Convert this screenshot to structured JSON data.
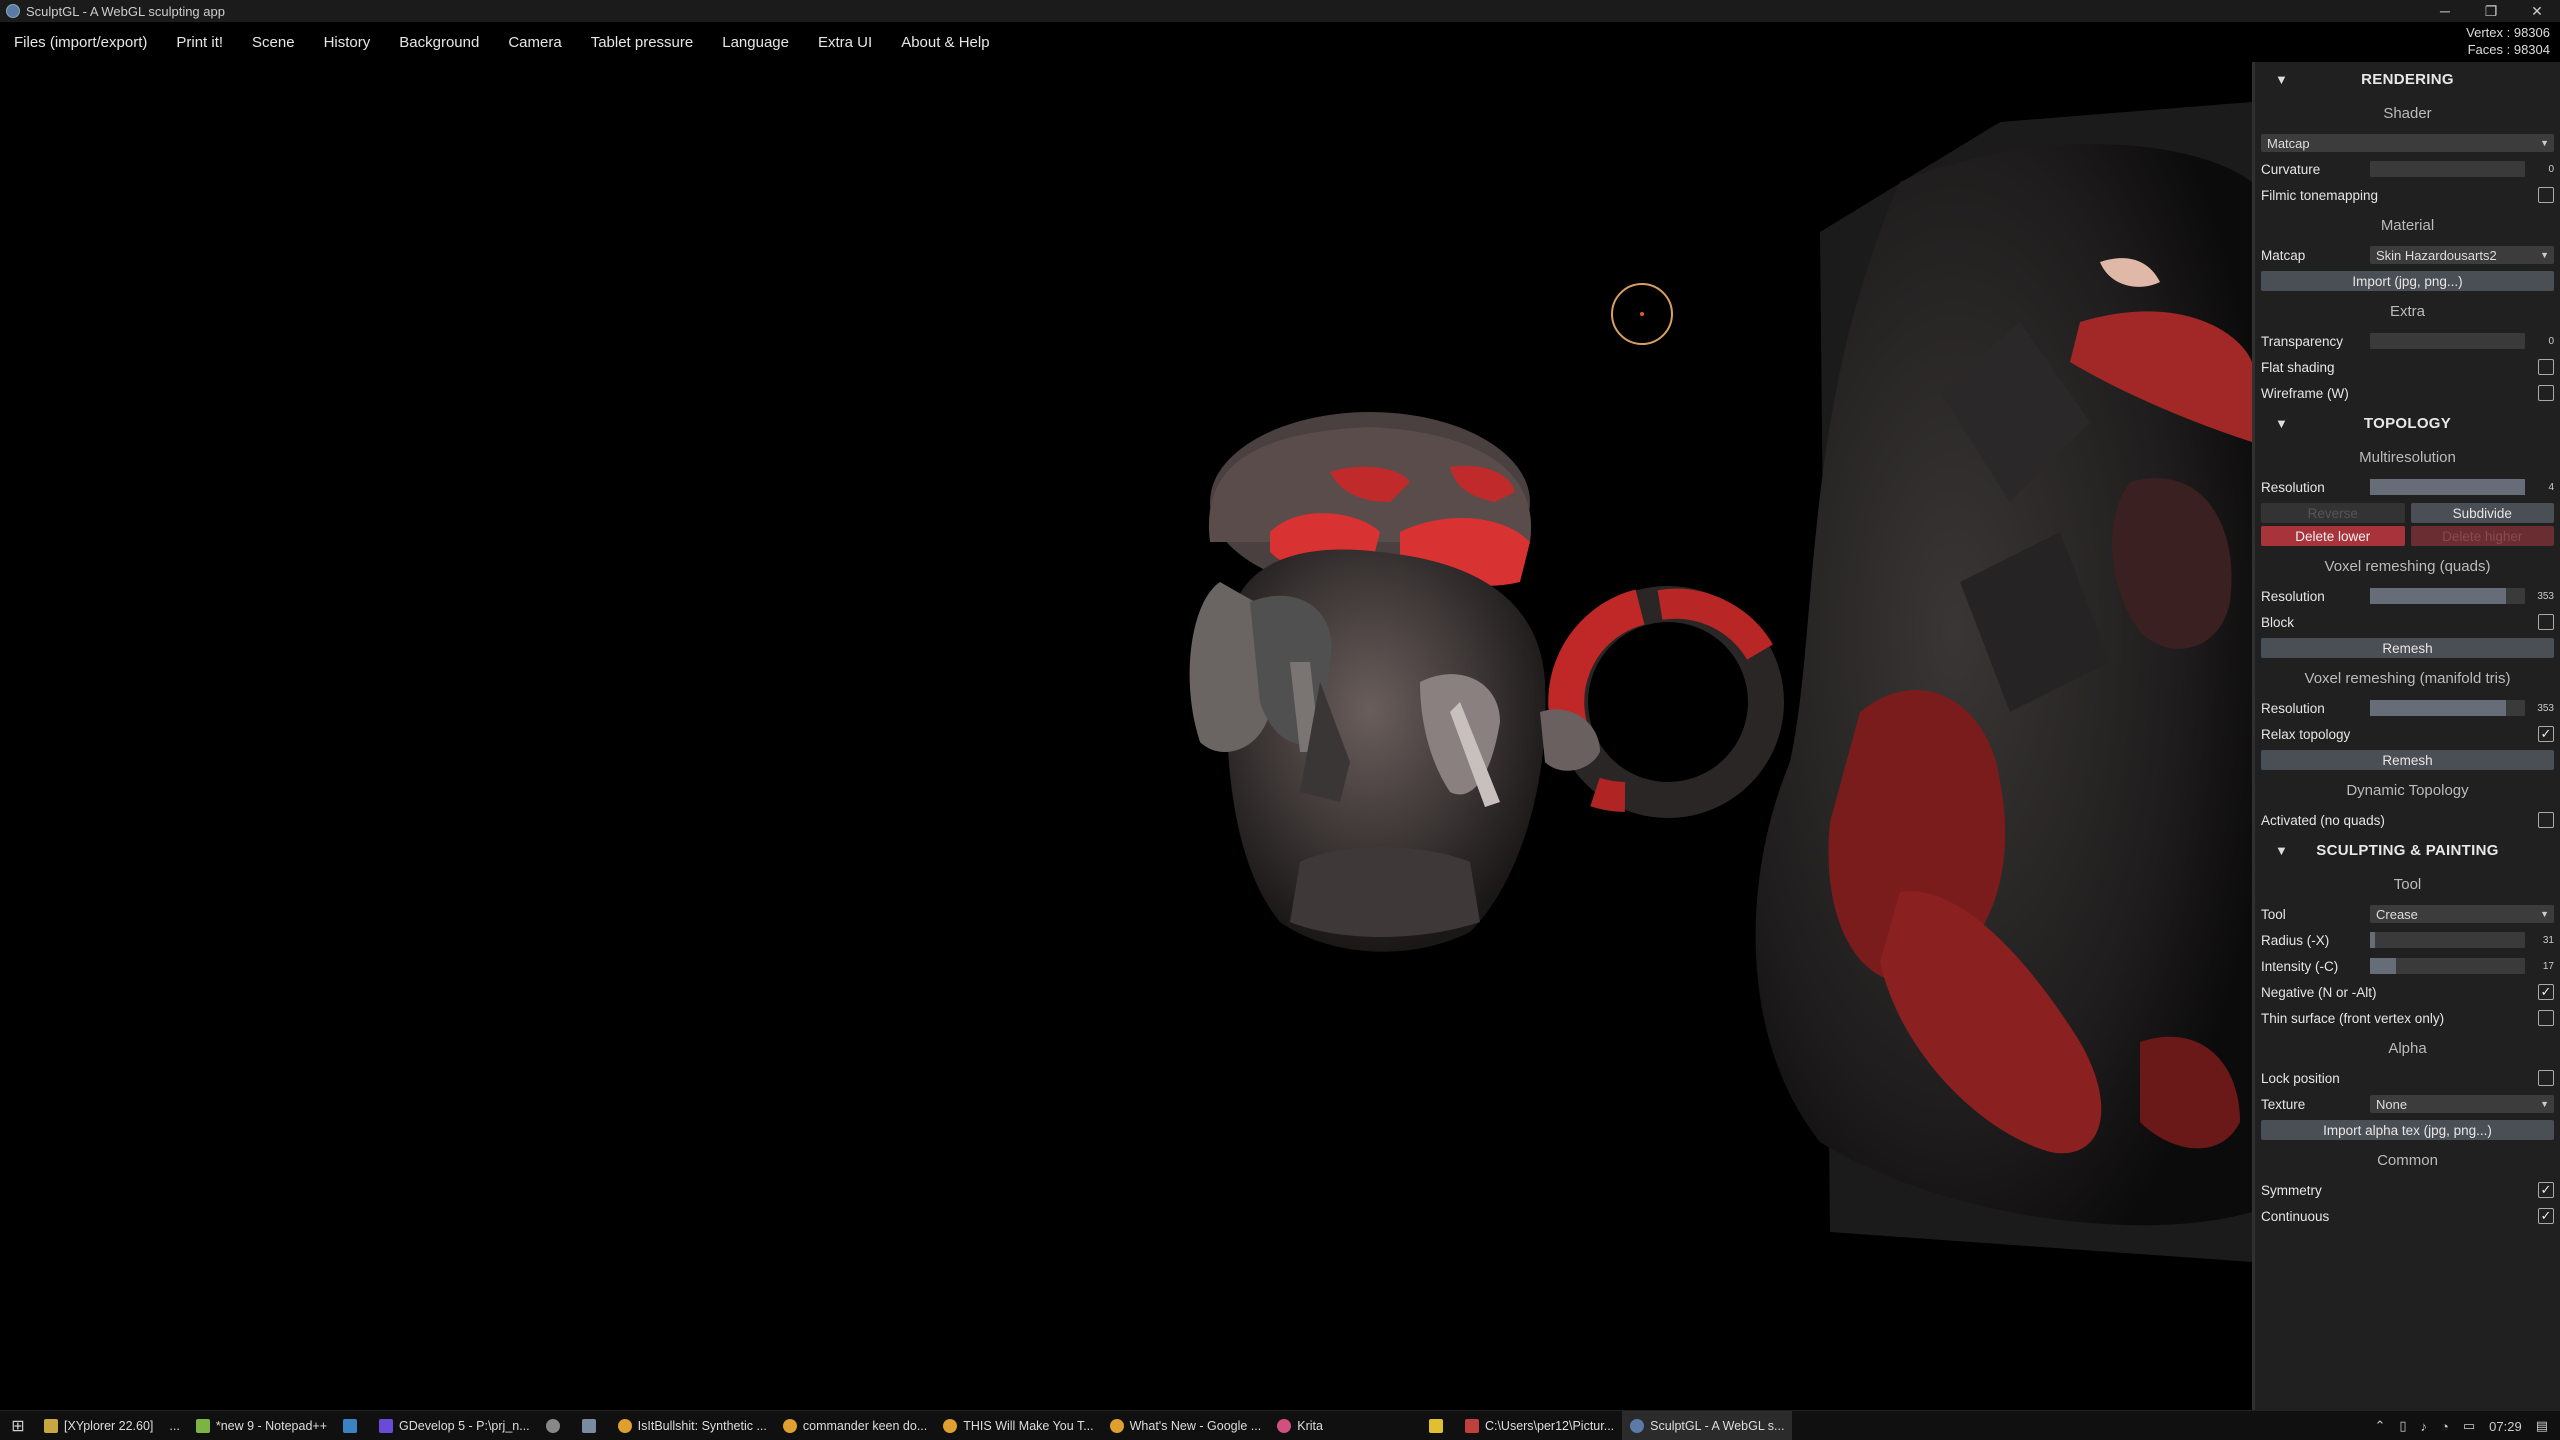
{
  "window": {
    "title": "SculptGL - A WebGL sculpting app"
  },
  "stats": {
    "vertex": "Vertex : 98306",
    "faces": "Faces : 98304"
  },
  "menu": [
    "Files (import/export)",
    "Print it!",
    "Scene",
    "History",
    "Background",
    "Camera",
    "Tablet pressure",
    "Language",
    "Extra UI",
    "About & Help"
  ],
  "panel": {
    "rendering": {
      "title": "RENDERING",
      "shader_header": "Shader",
      "shader_value": "Matcap",
      "curvature_label": "Curvature",
      "curvature_value": "0",
      "filmic_label": "Filmic tonemapping",
      "filmic_checked": false,
      "material_header": "Material",
      "matcap_label": "Matcap",
      "matcap_value": "Skin Hazardousarts2",
      "import_label": "Import (jpg, png...)",
      "extra_header": "Extra",
      "transparency_label": "Transparency",
      "transparency_value": "0",
      "flat_label": "Flat shading",
      "flat_checked": false,
      "wireframe_label": "Wireframe (W)",
      "wireframe_checked": false
    },
    "topology": {
      "title": "TOPOLOGY",
      "multires_header": "Multiresolution",
      "resolution_label": "Resolution",
      "resolution_value": "4",
      "reverse_label": "Reverse",
      "subdivide_label": "Subdivide",
      "delete_lower_label": "Delete lower",
      "delete_higher_label": "Delete higher",
      "voxel_quads_header": "Voxel remeshing (quads)",
      "vq_resolution_label": "Resolution",
      "vq_resolution_value": "353",
      "block_label": "Block",
      "block_checked": false,
      "remesh_label": "Remesh",
      "voxel_tris_header": "Voxel remeshing (manifold tris)",
      "vt_resolution_label": "Resolution",
      "vt_resolution_value": "353",
      "relax_label": "Relax topology",
      "relax_checked": true,
      "remesh2_label": "Remesh",
      "dynamic_header": "Dynamic Topology",
      "activated_label": "Activated (no quads)",
      "activated_checked": false
    },
    "sculpting": {
      "title": "SCULPTING & PAINTING",
      "tool_header": "Tool",
      "tool_label": "Tool",
      "tool_value": "Crease",
      "radius_label": "Radius (-X)",
      "radius_value": "31",
      "radius_fraction": 0.03,
      "intensity_label": "Intensity (-C)",
      "intensity_value": "17",
      "intensity_fraction": 0.17,
      "negative_label": "Negative (N or -Alt)",
      "negative_checked": true,
      "thin_label": "Thin surface (front vertex only)",
      "thin_checked": false,
      "alpha_header": "Alpha",
      "lock_label": "Lock position",
      "lock_checked": false,
      "texture_label": "Texture",
      "texture_value": "None",
      "import_alpha_label": "Import alpha tex (jpg, png...)",
      "common_header": "Common",
      "symmetry_label": "Symmetry",
      "symmetry_checked": true,
      "continuous_label": "Continuous",
      "continuous_checked": true
    }
  },
  "taskbar": {
    "tasks": [
      {
        "label": "[XYplorer 22.60]",
        "color": "#c8a640"
      },
      {
        "label": "...",
        "color": ""
      },
      {
        "label": "*new 9 - Notepad++",
        "color": "#7cb342"
      },
      {
        "label": "",
        "color": "#3b82c4"
      },
      {
        "label": "GDevelop 5 - P:\\prj_n...",
        "color": "#6a4bd8"
      },
      {
        "label": "",
        "color": "#888888"
      },
      {
        "label": "",
        "color": "#7a8aa0"
      },
      {
        "label": "IsItBullshit: Synthetic ...",
        "color": "#e0a030"
      },
      {
        "label": "commander keen do...",
        "color": "#e0a030"
      },
      {
        "label": "THIS Will Make You T...",
        "color": "#e0a030"
      },
      {
        "label": "What's New - Google ...",
        "color": "#e0a030"
      },
      {
        "label": "Krita",
        "color": "#d05080"
      },
      {
        "label": "",
        "color": "#e0c030"
      },
      {
        "label": "C:\\Users\\per12\\Pictur...",
        "color": "#c04040"
      },
      {
        "label": "SculptGL - A WebGL s...",
        "color": "#5a7aa8"
      }
    ],
    "clock": "07:29"
  }
}
